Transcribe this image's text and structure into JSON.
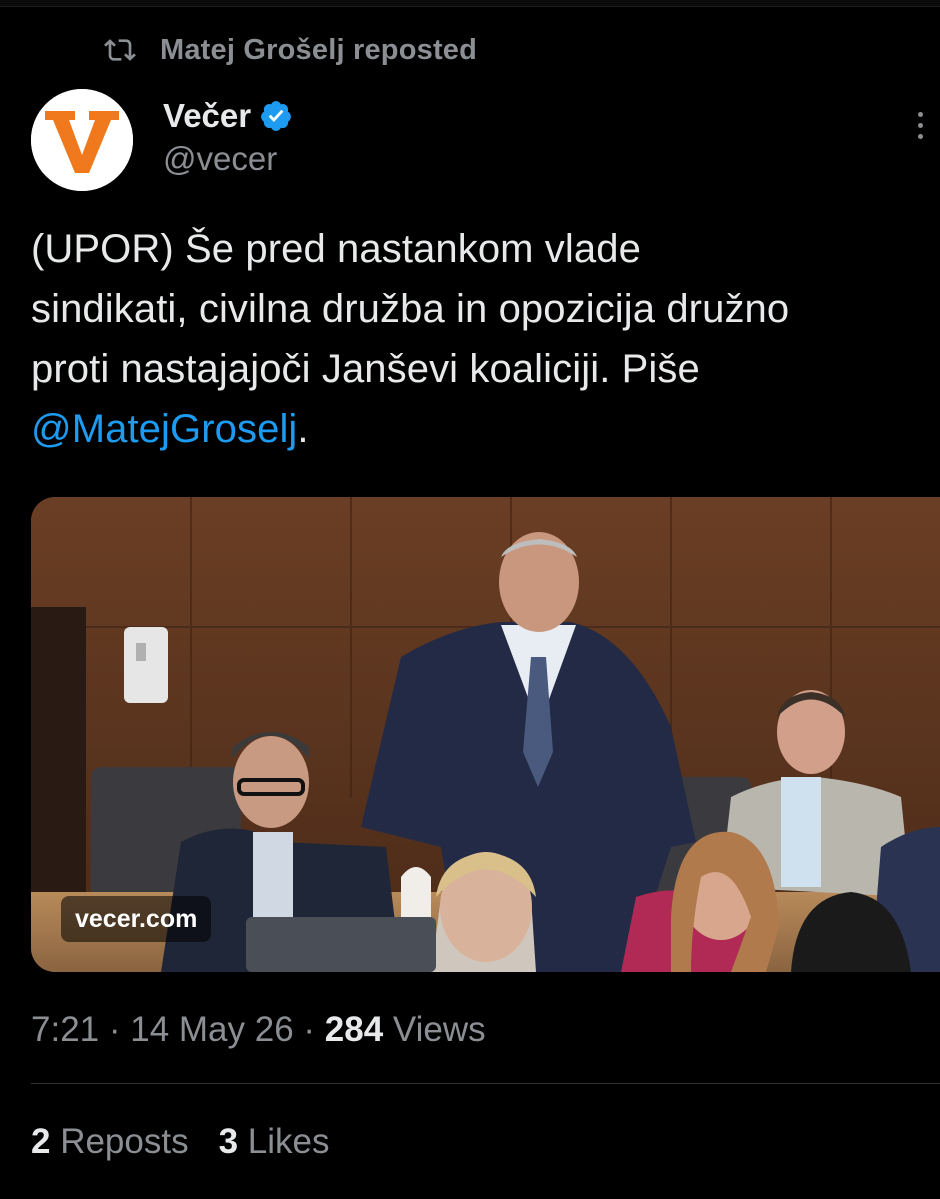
{
  "repost": {
    "text": "Matej Grošelj reposted"
  },
  "author": {
    "name": "Večer",
    "handle": "@vecer",
    "avatar_letter": "V",
    "verified": true
  },
  "tweet": {
    "lines": [
      "(UPOR) Še pred nastankom vlade",
      "sindikati, civilna družba in opozicija družno",
      "proti nastajajoči Janševi koaliciji. Piše"
    ],
    "mention": "@MatejGroselj",
    "mention_suffix": "."
  },
  "media": {
    "link_label": "vecer.com"
  },
  "meta": {
    "time": "7:21",
    "sep1": " · ",
    "date": "14 May 26",
    "sep2": " · ",
    "views_count": "284",
    "views_label": " Views"
  },
  "stats": {
    "reposts_count": "2",
    "reposts_label": " Reposts",
    "likes_count": "3",
    "likes_label": " Likes"
  },
  "colors": {
    "background": "#000000",
    "text": "#e7e9ea",
    "muted": "#8b8f94",
    "link": "#1d9bf0",
    "brand_orange": "#f0791e",
    "verified_blue": "#1d9bf0"
  },
  "icons": {
    "repost": "repost-icon",
    "verified": "verified-badge-icon",
    "more": "more-vertical-icon"
  }
}
